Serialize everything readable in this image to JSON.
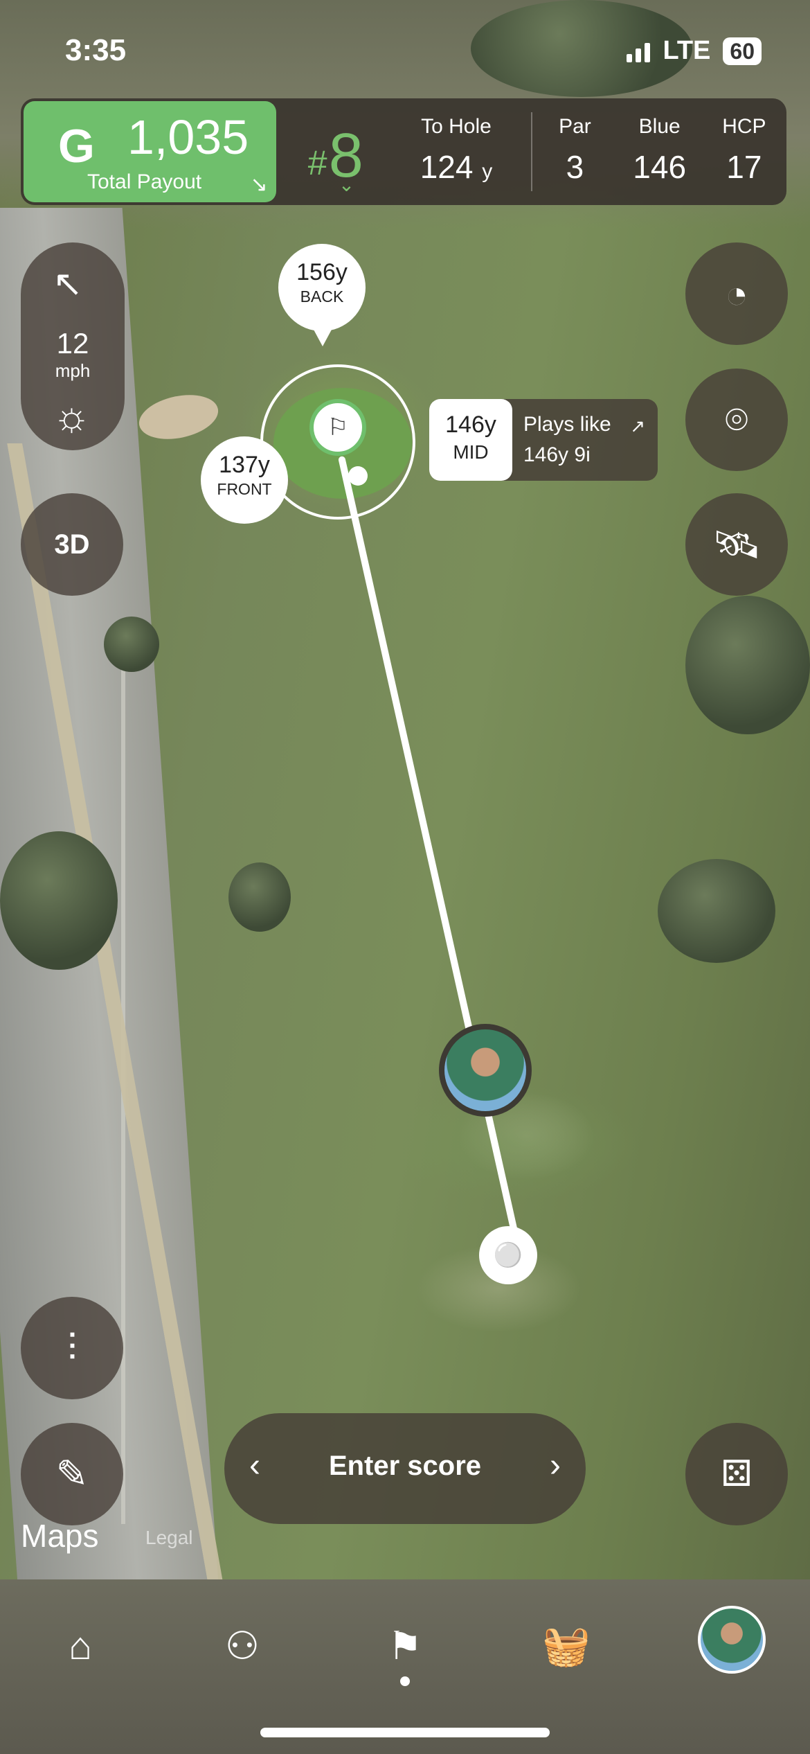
{
  "status_bar": {
    "time": "3:35",
    "network": "LTE",
    "battery": "60"
  },
  "header": {
    "payout_amount": "1,035",
    "payout_label": "Total Payout",
    "hole_number": "8",
    "to_hole_label": "To Hole",
    "to_hole_value": "124",
    "to_hole_unit": "y",
    "par_label": "Par",
    "par_value": "3",
    "tee_label": "Blue",
    "tee_value": "146",
    "hcp_label": "HCP",
    "hcp_value": "17"
  },
  "wind": {
    "speed": "12",
    "unit": "mph"
  },
  "view_toggle": "3D",
  "markers": {
    "back": {
      "distance": "156y",
      "label": "BACK"
    },
    "front": {
      "distance": "137y",
      "label": "FRONT"
    },
    "mid": {
      "distance": "146y",
      "label": "MID"
    }
  },
  "plays_like": {
    "title": "Plays like",
    "detail": "146y  9i"
  },
  "enter_score": "Enter score",
  "map_attribution": {
    "brand": "Maps",
    "legal": "Legal"
  },
  "icons": {
    "right_rail": [
      "shot-tracker-icon",
      "location-pin-icon",
      "satellite-icon"
    ],
    "left_rail": [
      "sliders-icon",
      "scorecard-edit-icon"
    ],
    "tabs": [
      "home-icon",
      "friends-icon",
      "golf-flag-icon",
      "shop-basket-icon",
      "profile-avatar"
    ]
  },
  "colors": {
    "accent": "#6fbf6c",
    "panel": "#3a342e"
  }
}
